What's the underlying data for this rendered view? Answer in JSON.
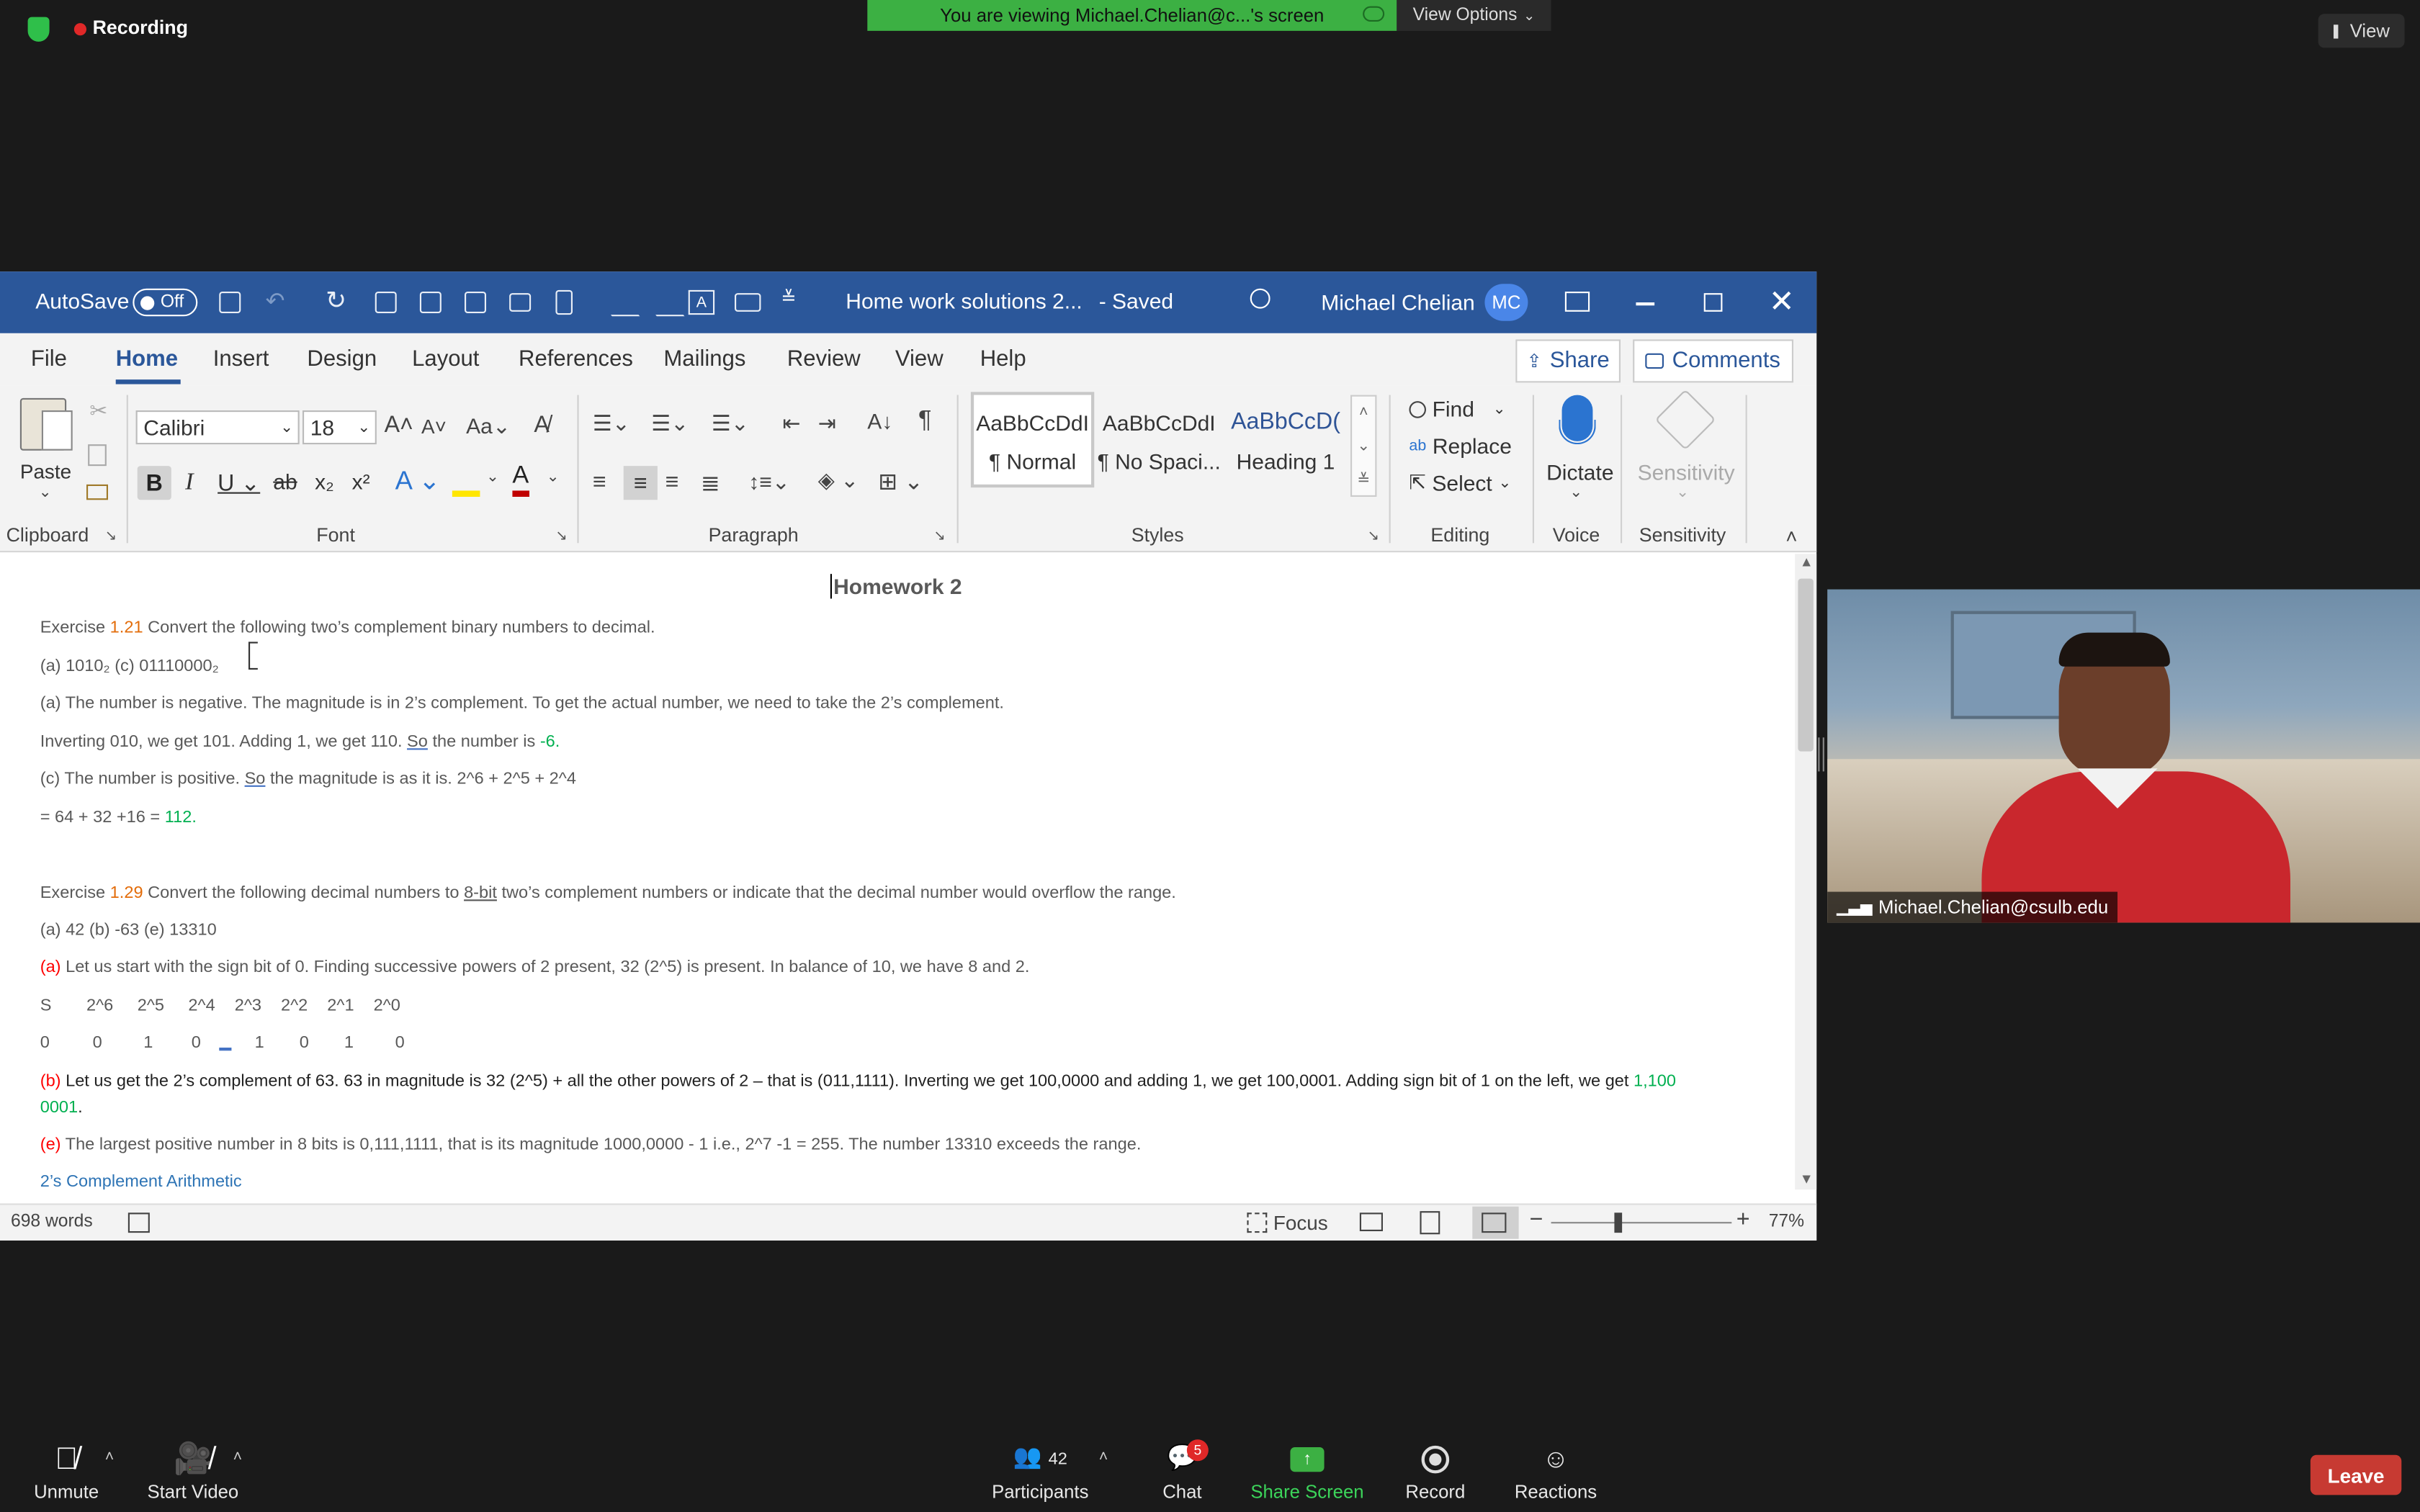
{
  "zoom": {
    "recording_label": "Recording",
    "banner_text": "You are viewing Michael.Chelian@c...'s screen",
    "view_options_label": "View Options",
    "view_label": "View",
    "participant_name": "Michael.Chelian@csulb.edu",
    "toolbar": {
      "unmute": "Unmute",
      "start_video": "Start Video",
      "participants": "Participants",
      "participants_count": "42",
      "chat": "Chat",
      "chat_badge": "5",
      "share_screen": "Share Screen",
      "record": "Record",
      "reactions": "Reactions",
      "leave": "Leave"
    }
  },
  "word": {
    "autosave_label": "AutoSave",
    "autosave_state": "Off",
    "doc_title": "Home work solutions 2...",
    "saved_status": "-  Saved",
    "user_name": "Michael Chelian",
    "user_initials": "MC",
    "tabs": [
      "File",
      "Home",
      "Insert",
      "Design",
      "Layout",
      "References",
      "Mailings",
      "Review",
      "View",
      "Help"
    ],
    "share_label": "Share",
    "comments_label": "Comments",
    "ribbon": {
      "paste": "Paste",
      "font_name": "Calibri",
      "font_size": "18",
      "styles": [
        {
          "preview": "AaBbCcDdI",
          "name": "¶ Normal"
        },
        {
          "preview": "AaBbCcDdI",
          "name": "¶ No Spaci..."
        },
        {
          "preview": "AaBbCcD(",
          "name": "Heading 1"
        }
      ],
      "find": "Find",
      "replace": "Replace",
      "select": "Select",
      "dictate": "Dictate",
      "sensitivity": "Sensitivity",
      "groups": [
        "Clipboard",
        "Font",
        "Paragraph",
        "Styles",
        "Editing",
        "Voice",
        "Sensitivity"
      ]
    },
    "document": {
      "heading": "Homework 2",
      "ex121_prefix": "Exercise ",
      "ex121_num": "1.21",
      "ex121_text": " Convert the following two’s complement binary numbers to decimal.",
      "ex121_items": "(a) 1010₂ (c) 01110000₂",
      "a_line1": "(a) The number is negative. The magnitude is in 2’s complement. To get the actual number, we need to take the 2’s complement.",
      "a_line2_pre": "Inverting 010, we get 101. Adding 1, we get 110. ",
      "a_line2_so": "So",
      "a_line2_mid": " the number is ",
      "a_line2_val": "-6.",
      "c_line1_pre": "(c) The number is positive. ",
      "c_line1_so": "So",
      "c_line1_post": " the magnitude is as it is. 2^6 + 2^5 + 2^4",
      "c_line2_pre": "= 64 + 32 +16 = ",
      "c_line2_val": "112.",
      "ex129_prefix": "Exercise ",
      "ex129_num": "1.29",
      "ex129_text_a": " Convert the following decimal numbers to ",
      "ex129_8bit": "8-bit",
      "ex129_text_b": " two’s complement numbers or indicate that the decimal number would overflow the range.",
      "ex129_items": "(a) 42 (b) -63 (e) 13310",
      "p_a_label": "(a)",
      "p_a_text": " Let us start with the sign bit of 0. Finding successive powers of 2 present, 32 (2^5) is present. In balance of 10, we have 8 and 2.",
      "powers_row": [
        "S",
        "2^6",
        "2^5",
        "2^4",
        "2^3",
        "2^2",
        "2^1",
        "2^0"
      ],
      "bits_row": [
        "0",
        "0",
        "1",
        "0",
        "1",
        "0",
        "1",
        "0"
      ],
      "p_b_label": "(b)",
      "p_b_text": "  Let us get the 2’s complement of 63. 63 in magnitude is 32 (2^5) + all the other powers of 2 – that is (011,1111). Inverting we get 100,0000 and adding 1, we get 100,0001. Adding sign bit of 1 on the left, we get ",
      "p_b_val1": "1,100",
      "p_b_val2": "0001",
      "p_b_end": ".",
      "p_e_label": "(e)",
      "p_e_text": " The largest positive number in 8 bits is 0,111,1111, that is its magnitude 1000,0000 - 1 i.e., 2^7 -1 = 255. The number 13310 exceeds the range.",
      "section_heading": "2’s Complement Arithmetic"
    },
    "status": {
      "word_count": "698 words",
      "focus": "Focus",
      "zoom_level": "77%"
    }
  },
  "colors": {
    "word_blue": "#2b579a",
    "zoom_green": "#3cb043",
    "leave_red": "#c73a32",
    "accent_orange": "#e36c09",
    "accent_green": "#00b050",
    "accent_red": "#ff0000",
    "link_blue": "#2e74b5"
  }
}
